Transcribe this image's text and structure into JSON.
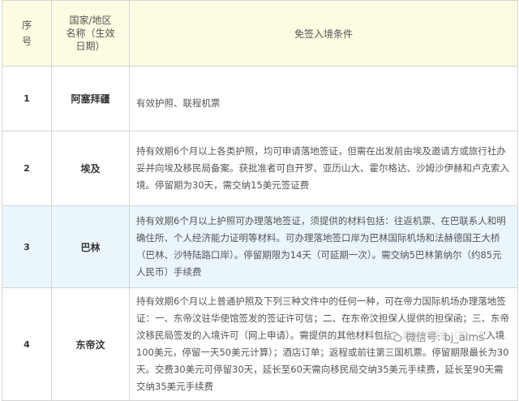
{
  "header": {
    "no": "序号",
    "name": "国家/地区名称（生效日期）",
    "cond": "免签入境条件"
  },
  "rows": [
    {
      "no": "1",
      "name": "阿塞拜疆",
      "cond": "有效护照、联程机票"
    },
    {
      "no": "2",
      "name": "埃及",
      "cond": "持有效期6个月以上各类护照，均可申请落地签证，但需在出发前由埃及邀请方或旅行社办妥并向埃及移民局备案。获批准者可自开罗、亚历山大、霍尔格达、沙姆沙伊赫和卢克索入境。停留期为30天，需交纳15美元签证费"
    },
    {
      "no": "3",
      "name": "巴林",
      "cond": "持有效期6个月以上护照可办理落地签证，须提供的材料包括：往返机票、在巴联系人和明确住所、个人经济能力证明等材料。可办理落地签口岸为巴林国际机场和法赫德国王大桥（巴林、沙特陆路口岸）。停留期限为14天（可延期一次）。需交纳5巴林第纳尔（约85元人民币）手续费"
    },
    {
      "no": "4",
      "name": "东帝汶",
      "cond": "持有效期6个月以上普通护照及下列三种文件中的任何一种，可在帝力国际机场办理落地签证：一、东帝汶驻华使馆签发的签证许可信；二、在东帝汶担保人提供的担保函；三、东帝汶移民局签发的入境许可（网上申请）。需提供的其他材料包括：足够的现金（按一次入境100美元，停留一天50美元计算）；酒店订单；返程或前往第三国机票。停留期限最长为30天。交费30美元可停留30天，延长至60天需向移民局交纳35美元手续费，延长至90天需交纳35美元手续费"
    }
  ],
  "watermark": "微信号: bj_aims"
}
